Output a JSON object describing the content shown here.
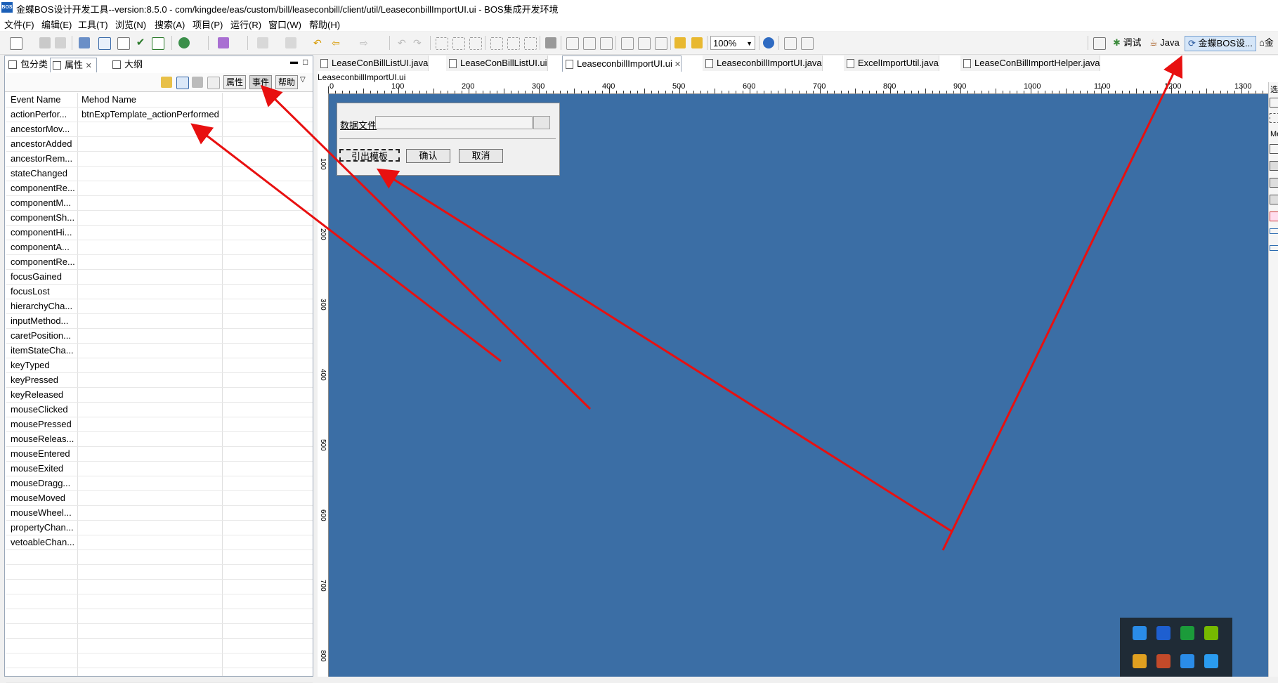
{
  "titlebar": {
    "logo_text": "BOS",
    "title": "金蝶BOS设计开发工具--version:8.5.0  -  com/kingdee/eas/custom/bill/leaseconbill/client/util/LeaseconbillImportUI.ui  -  BOS集成开发环境"
  },
  "menubar": {
    "items": [
      "文件(F)",
      "编辑(E)",
      "工具(T)",
      "浏览(N)",
      "搜索(A)",
      "项目(P)",
      "运行(R)",
      "窗口(W)",
      "帮助(H)"
    ]
  },
  "toolbar": {
    "zoom_value": "100%",
    "perspectives": [
      "调试",
      "Java",
      "金蝶BOS设...",
      "金"
    ]
  },
  "left_panel": {
    "tabs": [
      "包分类",
      "属性",
      "大纲"
    ],
    "active_tab": "属性",
    "buttons": [
      "属性",
      "事件",
      "帮助"
    ],
    "columns": [
      "Event Name",
      "Mehod Name"
    ],
    "events": [
      {
        "name": "actionPerfor...",
        "method": "btnExpTemplate_actionPerformed"
      },
      {
        "name": "ancestorMov...",
        "method": ""
      },
      {
        "name": "ancestorAdded",
        "method": ""
      },
      {
        "name": "ancestorRem...",
        "method": ""
      },
      {
        "name": "stateChanged",
        "method": ""
      },
      {
        "name": "componentRe...",
        "method": ""
      },
      {
        "name": "componentM...",
        "method": ""
      },
      {
        "name": "componentSh...",
        "method": ""
      },
      {
        "name": "componentHi...",
        "method": ""
      },
      {
        "name": "componentA...",
        "method": ""
      },
      {
        "name": "componentRe...",
        "method": ""
      },
      {
        "name": "focusGained",
        "method": ""
      },
      {
        "name": "focusLost",
        "method": ""
      },
      {
        "name": "hierarchyCha...",
        "method": ""
      },
      {
        "name": "inputMethod...",
        "method": ""
      },
      {
        "name": "caretPosition...",
        "method": ""
      },
      {
        "name": "itemStateCha...",
        "method": ""
      },
      {
        "name": "keyTyped",
        "method": ""
      },
      {
        "name": "keyPressed",
        "method": ""
      },
      {
        "name": "keyReleased",
        "method": ""
      },
      {
        "name": "mouseClicked",
        "method": ""
      },
      {
        "name": "mousePressed",
        "method": ""
      },
      {
        "name": "mouseReleas...",
        "method": ""
      },
      {
        "name": "mouseEntered",
        "method": ""
      },
      {
        "name": "mouseExited",
        "method": ""
      },
      {
        "name": "mouseDragg...",
        "method": ""
      },
      {
        "name": "mouseMoved",
        "method": ""
      },
      {
        "name": "mouseWheel...",
        "method": ""
      },
      {
        "name": "propertyChan...",
        "method": ""
      },
      {
        "name": "vetoableChan...",
        "method": ""
      }
    ]
  },
  "editor": {
    "tabs": [
      {
        "label": "LeaseConBillListUI.java",
        "active": false
      },
      {
        "label": "LeaseConBillListUI.ui",
        "active": false
      },
      {
        "label": "LeaseconbillImportUI.ui",
        "active": true
      },
      {
        "label": "LeaseconbillImportUI.java",
        "active": false
      },
      {
        "label": "ExcelImportUtil.java",
        "active": false
      },
      {
        "label": "LeaseConBillImportHelper.java",
        "active": false
      }
    ],
    "file_title": "LeaseconbillImportUI.ui",
    "hruler": [
      "0",
      "100",
      "200",
      "300",
      "400",
      "500",
      "600",
      "700",
      "800",
      "900",
      "1000",
      "1100",
      "1200",
      "1300"
    ],
    "vruler": [
      "100",
      "200",
      "300",
      "400",
      "500",
      "600",
      "700",
      "800"
    ],
    "canvas_color": "#3b6ea5",
    "dialog": {
      "data_file_label": "数据文件",
      "export_template": "引出模板",
      "confirm": "确认",
      "cancel": "取消"
    },
    "palette_labels": [
      "选",
      "Me"
    ]
  },
  "annotation_color": "#e81010",
  "tray_icons": [
    "feishu-icon",
    "bluetooth-icon",
    "ime-icon",
    "nvidia-icon",
    "security-icon",
    "volume-icon",
    "network-icon",
    "browser-icon"
  ]
}
